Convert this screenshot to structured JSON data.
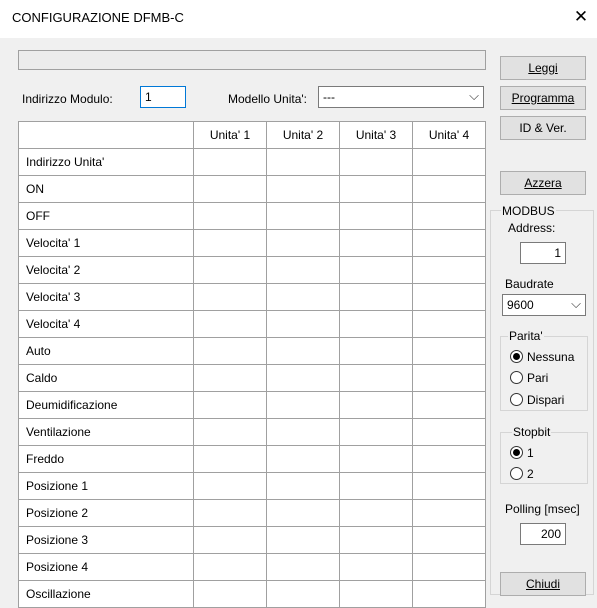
{
  "window": {
    "title": "CONFIGURAZIONE DFMB-C"
  },
  "module": {
    "address_label": "Indirizzo Modulo:",
    "address_value": "1",
    "model_label": "Modello Unita':",
    "model_value": "---"
  },
  "buttons": {
    "leggi": "Leggi",
    "programma": "Programma",
    "id_ver": "ID & Ver.",
    "azzera": "Azzera",
    "chiudi": "Chiudi"
  },
  "table": {
    "columns": [
      "Unita' 1",
      "Unita' 2",
      "Unita' 3",
      "Unita' 4"
    ],
    "rows": [
      "Indirizzo Unita'",
      "ON",
      "OFF",
      "Velocita' 1",
      "Velocita' 2",
      "Velocita' 3",
      "Velocita' 4",
      "Auto",
      "Caldo",
      "Deumidificazione",
      "Ventilazione",
      "Freddo",
      "Posizione 1",
      "Posizione 2",
      "Posizione 3",
      "Posizione 4",
      "Oscillazione"
    ]
  },
  "modbus": {
    "title": "MODBUS",
    "address_label": "Address:",
    "address_value": "1",
    "baudrate_label": "Baudrate",
    "baudrate_value": "9600",
    "parita_label": "Parita'",
    "parita_options": [
      "Nessuna",
      "Pari",
      "Dispari"
    ],
    "parita_selected": "Nessuna",
    "stopbit_label": "Stopbit",
    "stopbit_options": [
      "1",
      "2"
    ],
    "stopbit_selected": "1",
    "polling_label": "Polling [msec]",
    "polling_value": "200"
  },
  "icons": {
    "close": "close-icon",
    "dropdown": "chevron-down-icon"
  }
}
